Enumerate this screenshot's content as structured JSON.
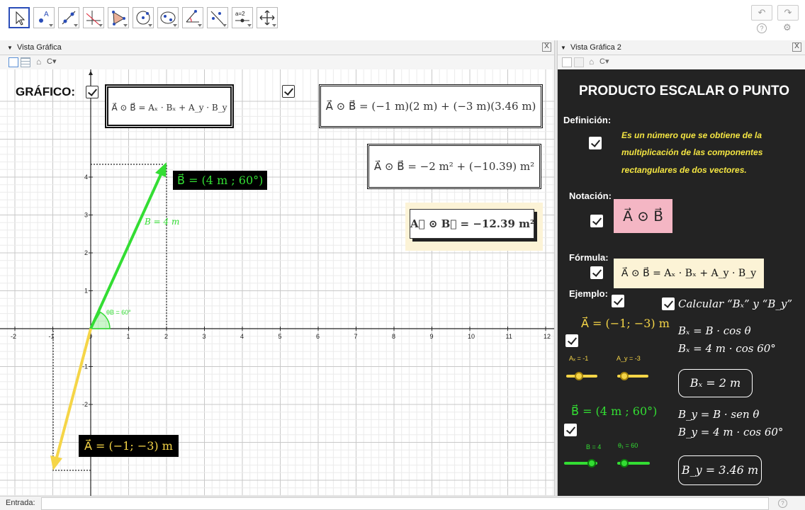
{
  "toolbar": {
    "tools": [
      {
        "name": "move-tool-icon",
        "selected": true
      },
      {
        "name": "point-tool-icon"
      },
      {
        "name": "line-tool-icon"
      },
      {
        "name": "perpendicular-tool-icon"
      },
      {
        "name": "polygon-tool-icon"
      },
      {
        "name": "circle-tool-icon"
      },
      {
        "name": "ellipse-tool-icon"
      },
      {
        "name": "angle-tool-icon"
      },
      {
        "name": "reflect-tool-icon"
      },
      {
        "name": "slider-tool-icon",
        "text": "a=2"
      },
      {
        "name": "move-view-tool-icon"
      }
    ],
    "undo_icon": "↶",
    "redo_icon": "↷",
    "help_icon": "?",
    "settings_icon": "⚙"
  },
  "left_panel": {
    "title": "Vista Gráfica",
    "close": "X"
  },
  "right_panel": {
    "title": "Vista Gráfica 2",
    "close": "X"
  },
  "subbar": {
    "home": "⌂",
    "cmode": "C▾"
  },
  "graph": {
    "title": "GRÁFICO:",
    "x_ticks": [
      "-2",
      "-1",
      "0",
      "1",
      "2",
      "3",
      "4",
      "5",
      "6",
      "7",
      "8",
      "9",
      "10",
      "11",
      "12"
    ],
    "y_ticks": [
      "4",
      "3",
      "2",
      "1",
      "-1",
      "-2",
      "-3"
    ],
    "formula_general": "A⃗ ⊙ B⃗ = Aₓ · Bₓ + A_y · B_y",
    "formula_sub": "A⃗ ⊙ B⃗ = (−1 m)(2 m) + (−3 m)(3.46 m)",
    "formula_sq": "A⃗ ⊙ B⃗ = −2 m² + (−10.39) m²",
    "result": "A⃗ ⊙ B⃗ = −12.39 m²",
    "vector_b_label": "B⃗ = (4 m ; 60°)",
    "vector_a_label": "A⃗ = (−1; −3) m",
    "b_mag_label": "B = 4 m",
    "angle_label": "θB = 60°"
  },
  "right": {
    "title": "PRODUCTO ESCALAR O PUNTO",
    "definicion": "Definición:",
    "def_text": [
      "Es un número que se obtiene de la",
      "multiplicación de las componentes",
      "rectangulares de dos vectores."
    ],
    "notacion": "Notación:",
    "notacion_formula": "A⃗ ⊙ B⃗",
    "formula": "Fórmula:",
    "formula_text": "A⃗ ⊙ B⃗ = Aₓ · Bₓ + A_y · B_y",
    "ejemplo": "Ejemplo:",
    "calcular": "Calcular “Bₓ” y “B_y”",
    "vec_a": "A⃗ = (−1; −3) m",
    "slider_ax": "Aₓ = -1",
    "slider_ay": "A_y = -3",
    "vec_b": "B⃗ = (4 m ; 60°)",
    "slider_b": "B = 4",
    "slider_theta": "θ₁ = 60",
    "bx1": "Bₓ = B · cos θ",
    "bx2": "Bₓ = 4 m · cos 60°",
    "bx_res": "Bₓ = 2 m",
    "by1": "B_y = B · sen θ",
    "by2": "B_y = 4 m · cos 60°",
    "by_res": "B_y = 3.46 m"
  },
  "input_bar": {
    "label": "Entrada:",
    "help": "?"
  },
  "colors": {
    "green": "#33dd33",
    "yellow": "#f5d547",
    "dark": "#232323",
    "pink": "#f4b6c4",
    "cream": "#fcf3d6"
  }
}
